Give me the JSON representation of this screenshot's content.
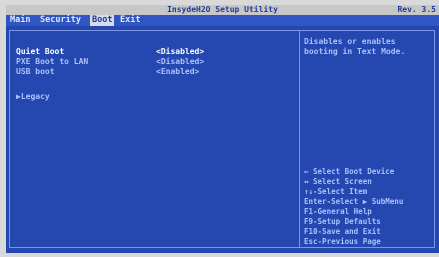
{
  "title_bar": {
    "title": "InsydeH2O Setup Utility",
    "version": "Rev. 3.5"
  },
  "menu": {
    "tabs": [
      {
        "label": "Main"
      },
      {
        "label": "Security"
      },
      {
        "label": "Boot",
        "active": true
      },
      {
        "label": "Exit"
      }
    ]
  },
  "settings": {
    "items": [
      {
        "label": "Quiet Boot",
        "value": "<Disabled>",
        "selected": true
      },
      {
        "label": "PXE Boot to LAN",
        "value": "<Disabled>"
      },
      {
        "label": "USB boot",
        "value": "<Enabled>"
      }
    ],
    "submenu": "▶Legacy"
  },
  "help": {
    "lines": [
      "Disables or enables",
      "booting in Text Mode."
    ]
  },
  "key_help": {
    "lines": [
      "←    Select Boot Device",
      "↔    Select Screen",
      "↑↓-Select Item",
      "Enter-Select ▶ SubMenu",
      "F1-General Help",
      "F9-Setup Defaults",
      "F10-Save and Exit",
      "Esc-Previous Page"
    ]
  },
  "colors": {
    "background": "#2547b0",
    "title_bar": "#c7c7c7",
    "active_tab": "#d6dbea",
    "text": "#a9c2ff",
    "selected_text": "#ffffff"
  }
}
